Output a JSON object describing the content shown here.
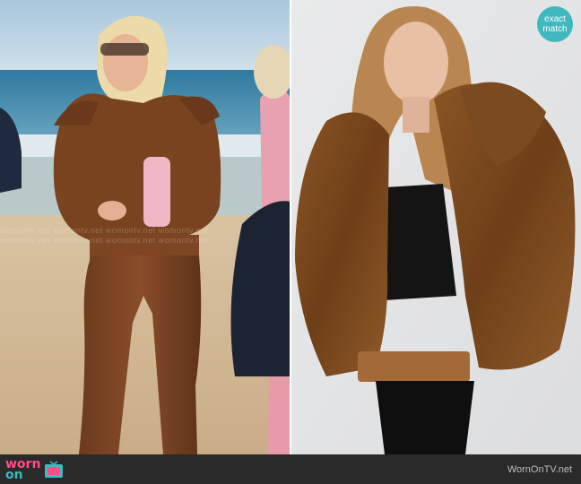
{
  "badge": {
    "line1": "exact",
    "line2": "match"
  },
  "watermark_text": "womontv.net womontv.net womontv.net womontv.net",
  "logo": {
    "word1": "worn",
    "word2": "on"
  },
  "site_credit": "WornOnTV.net",
  "colors": {
    "accent_teal": "#3fb8c0",
    "accent_pink": "#ff4d8a",
    "footer_bg": "#2a2a2a"
  }
}
